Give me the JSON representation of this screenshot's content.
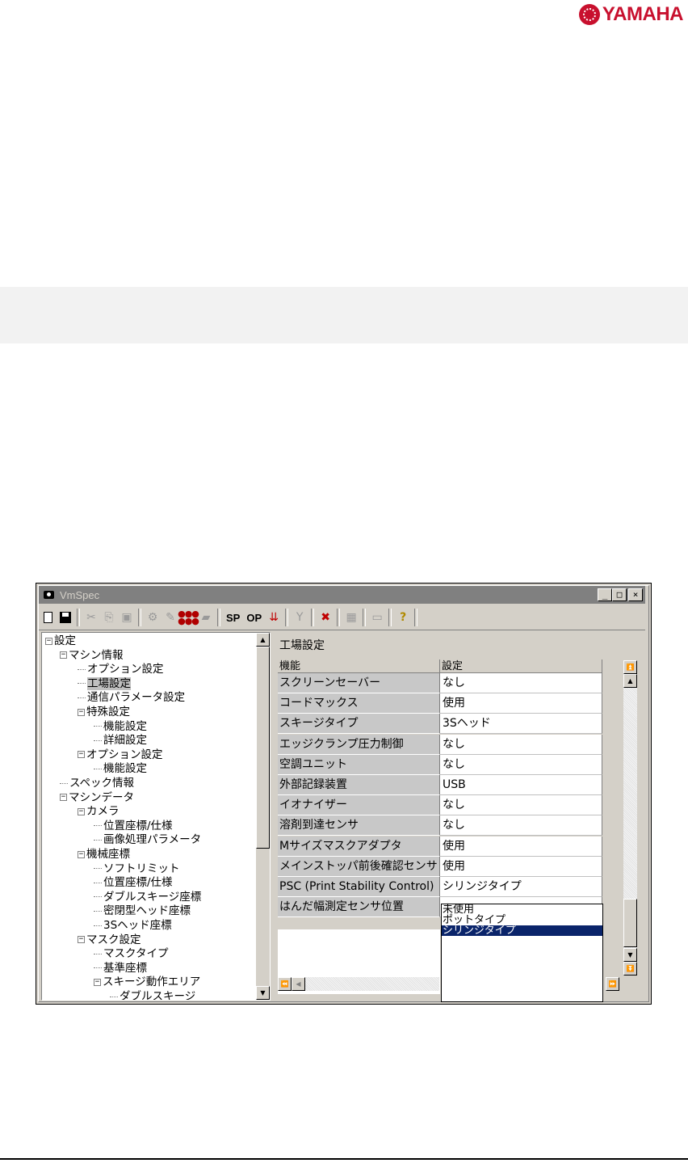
{
  "brand": {
    "logo_text": "YAMAHA",
    "color": "#c8102e"
  },
  "window": {
    "title": "VmSpec",
    "caption_buttons": {
      "minimize": "_",
      "maximize": "□",
      "close": "×"
    }
  },
  "toolbar": {
    "icons": [
      "new-file-icon",
      "save-icon",
      "cut-icon",
      "copy-icon",
      "paste-icon",
      "feeder-icon",
      "feeder-edit-icon",
      "dots-icon",
      "flag-icon",
      "sp-button",
      "op-button",
      "download-icon",
      "filter-icon",
      "plug-icon",
      "grid-icon",
      "keyboard-icon",
      "help-icon"
    ],
    "sp_label": "SP",
    "op_label": "OP",
    "help_glyph": "?"
  },
  "tree": {
    "items": [
      {
        "label": "設定",
        "level": 0,
        "expander": "−"
      },
      {
        "label": "マシン情報",
        "level": 1,
        "expander": "−"
      },
      {
        "label": "オプション設定",
        "level": 2
      },
      {
        "label": "工場設定",
        "level": 2,
        "selected": true
      },
      {
        "label": "通信パラメータ設定",
        "level": 2
      },
      {
        "label": "特殊設定",
        "level": 2,
        "expander": "−"
      },
      {
        "label": "機能設定",
        "level": 3
      },
      {
        "label": "詳細設定",
        "level": 3
      },
      {
        "label": "オプション設定",
        "level": 2,
        "expander": "−"
      },
      {
        "label": "機能設定",
        "level": 3
      },
      {
        "label": "スペック情報",
        "level": 1
      },
      {
        "label": "マシンデータ",
        "level": 1,
        "expander": "−"
      },
      {
        "label": "カメラ",
        "level": 2,
        "expander": "−"
      },
      {
        "label": "位置座標/仕様",
        "level": 3
      },
      {
        "label": "画像処理パラメータ",
        "level": 3
      },
      {
        "label": "機械座標",
        "level": 2,
        "expander": "−"
      },
      {
        "label": "ソフトリミット",
        "level": 3
      },
      {
        "label": "位置座標/仕様",
        "level": 3
      },
      {
        "label": "ダブルスキージ座標",
        "level": 3
      },
      {
        "label": "密閉型ヘッド座標",
        "level": 3
      },
      {
        "label": "3Sヘッド座標",
        "level": 3
      },
      {
        "label": "マスク設定",
        "level": 2,
        "expander": "−"
      },
      {
        "label": "マスクタイプ",
        "level": 3
      },
      {
        "label": "基準座標",
        "level": 3
      },
      {
        "label": "スキージ動作エリア",
        "level": 3,
        "expander": "−"
      },
      {
        "label": "ダブルスキージ",
        "level": 4
      }
    ]
  },
  "panel": {
    "heading": "工場設定",
    "columns": [
      "機能",
      "設定"
    ],
    "rows": [
      {
        "feature": "スクリーンセーバー",
        "value": "なし"
      },
      {
        "feature": "コードマックス",
        "value": "使用"
      },
      {
        "feature": "スキージタイプ",
        "value": "3Sヘッド"
      },
      {
        "feature": "エッジクランプ圧力制御",
        "value": "なし"
      },
      {
        "feature": "空調ユニット",
        "value": "なし"
      },
      {
        "feature": "外部記録装置",
        "value": "USB"
      },
      {
        "feature": "イオナイザー",
        "value": "なし"
      },
      {
        "feature": "溶剤到達センサ",
        "value": "なし"
      },
      {
        "feature": "Mサイズマスクアダプタ",
        "value": "使用"
      },
      {
        "feature": "メインストッパ前後確認センサ",
        "value": "使用"
      },
      {
        "feature": "PSC (Print Stability Control)",
        "value": "シリンジタイプ"
      },
      {
        "feature": "はんだ幅測定センサ位置",
        "value": ""
      }
    ],
    "dropdown_options": [
      {
        "label": "未使用",
        "selected": false
      },
      {
        "label": "ポットタイプ",
        "selected": false
      },
      {
        "label": "シリンジタイプ",
        "selected": true
      }
    ]
  }
}
